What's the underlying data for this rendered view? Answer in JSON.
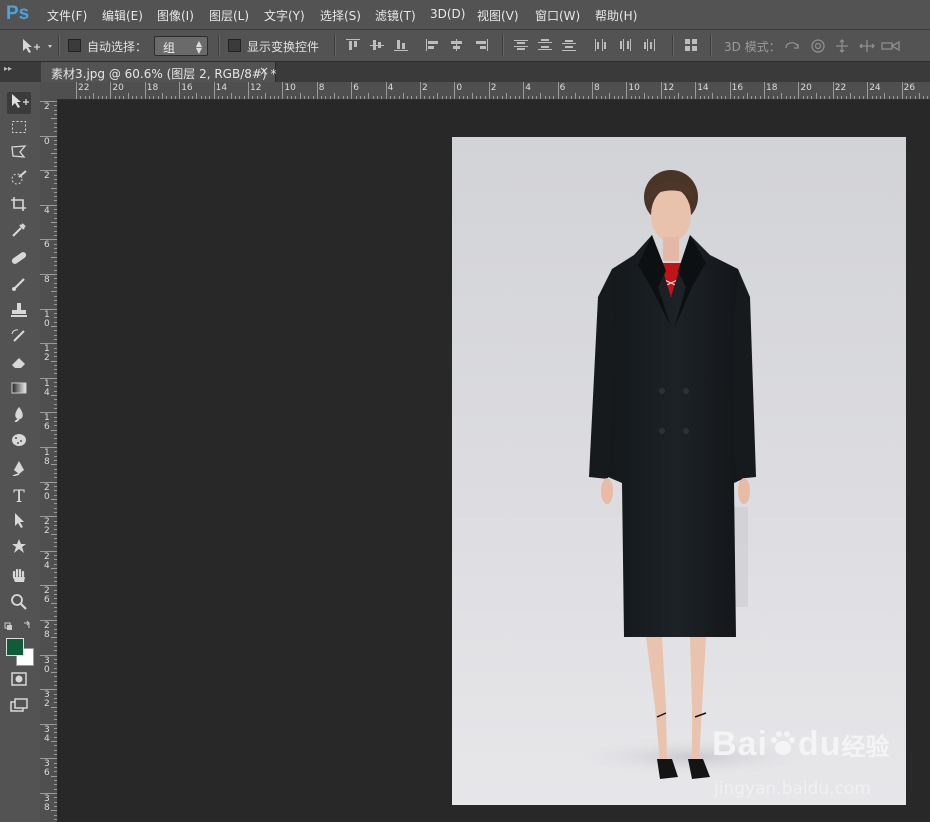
{
  "app": {
    "logo": "Ps"
  },
  "menu": [
    "文件(F)",
    "编辑(E)",
    "图像(I)",
    "图层(L)",
    "文字(Y)",
    "选择(S)",
    "滤镜(T)",
    "3D(D)",
    "视图(V)",
    "窗口(W)",
    "帮助(H)"
  ],
  "options": {
    "auto_select_label": "自动选择：",
    "auto_select_value": "组",
    "show_transform_label": "显示变换控件",
    "mode_3d_label": "3D 模式："
  },
  "document": {
    "tab_title": "素材3.jpg @ 60.6% (图层 2, RGB/8#) *",
    "close": "×"
  },
  "ruler": {
    "top_labels": [
      "22",
      "20",
      "18",
      "16",
      "14",
      "12",
      "10",
      "8",
      "6",
      "4",
      "2",
      "0",
      "2",
      "4",
      "6",
      "8",
      "10",
      "12",
      "14",
      "16",
      "18",
      "20",
      "22",
      "24",
      "26"
    ],
    "left_labels": [
      "2",
      "0",
      "2",
      "4",
      "6",
      "8",
      "10",
      "12",
      "14",
      "16",
      "18",
      "20",
      "22",
      "24",
      "26",
      "28",
      "30",
      "32",
      "34",
      "36",
      "38"
    ]
  },
  "colors": {
    "foreground": "#0e5c3a",
    "background": "#ffffff",
    "accent": "#4aa3e0",
    "panel": "#535353"
  },
  "tools": [
    "move-tool",
    "marquee-tool",
    "lasso-tool",
    "quick-select-tool",
    "crop-tool",
    "eyedropper-tool",
    "healing-brush-tool",
    "brush-tool",
    "clone-stamp-tool",
    "history-brush-tool",
    "eraser-tool",
    "gradient-tool",
    "blur-tool",
    "dodge-tool",
    "pen-tool",
    "type-tool",
    "path-select-tool",
    "shape-tool",
    "hand-tool",
    "zoom-tool"
  ],
  "type_tool_glyph": "T",
  "watermark": {
    "brand": "Bai",
    "brand2": "du",
    "cn": "经验",
    "url": "jingyan.baidu.com"
  }
}
